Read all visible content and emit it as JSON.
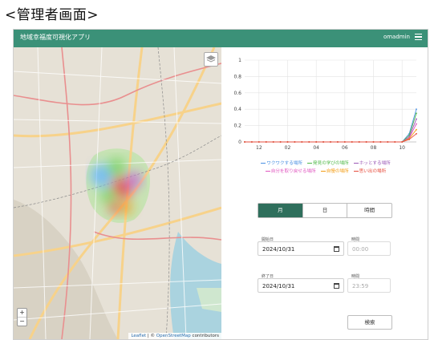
{
  "page": {
    "heading": "<管理者画面>"
  },
  "header": {
    "title": "地域幸福度可視化アプリ",
    "user": "omadmin"
  },
  "map": {
    "zoom_in": "+",
    "zoom_out": "−",
    "attribution": {
      "leaflet": "Leaflet",
      "sep": " | © ",
      "osm": "OpenStreetMap",
      "suffix": " contributors"
    }
  },
  "chart_data": {
    "type": "line",
    "x": [
      10,
      11,
      12,
      13,
      14,
      15,
      16,
      17,
      18,
      19,
      20,
      21,
      22,
      23,
      0,
      1,
      2,
      3,
      4,
      5,
      6,
      7,
      8,
      9,
      10
    ],
    "x_ticks": [
      "12",
      "02",
      "04",
      "06",
      "08",
      "10"
    ],
    "y_ticks": [
      "0",
      "0.2",
      "0.4",
      "0.6",
      "0.8",
      "1"
    ],
    "ylim": [
      0,
      1
    ],
    "grid": true,
    "legend_position": "bottom",
    "series": [
      {
        "name": "ワクワクする場所",
        "color": "#4a90e2",
        "values": [
          0,
          0,
          0,
          0,
          0,
          0,
          0,
          0,
          0,
          0,
          0,
          0,
          0,
          0,
          0,
          0,
          0,
          0,
          0,
          0,
          0,
          0,
          0,
          0.1,
          0.4
        ]
      },
      {
        "name": "発見の学びの場所",
        "color": "#50b848",
        "values": [
          0,
          0,
          0,
          0,
          0,
          0,
          0,
          0,
          0,
          0,
          0,
          0,
          0,
          0,
          0,
          0,
          0,
          0,
          0,
          0,
          0,
          0,
          0,
          0.08,
          0.35
        ]
      },
      {
        "name": "ホッとする場所",
        "color": "#9b59b6",
        "values": [
          0,
          0,
          0,
          0,
          0,
          0,
          0,
          0,
          0,
          0,
          0,
          0,
          0,
          0,
          0,
          0,
          0,
          0,
          0,
          0,
          0,
          0,
          0,
          0.06,
          0.28
        ]
      },
      {
        "name": "自分を取り戻せる場所",
        "color": "#e056c0",
        "values": [
          0,
          0,
          0,
          0,
          0,
          0,
          0,
          0,
          0,
          0,
          0,
          0,
          0,
          0,
          0,
          0,
          0,
          0,
          0,
          0,
          0,
          0,
          0,
          0.05,
          0.22
        ]
      },
      {
        "name": "自慢の場所",
        "color": "#f39c12",
        "values": [
          0,
          0,
          0,
          0,
          0,
          0,
          0,
          0,
          0,
          0,
          0,
          0,
          0,
          0,
          0,
          0,
          0,
          0,
          0,
          0,
          0,
          0,
          0,
          0.04,
          0.15
        ]
      },
      {
        "name": "思い出の場所",
        "color": "#e74c3c",
        "values": [
          0,
          0,
          0,
          0,
          0,
          0,
          0,
          0,
          0,
          0,
          0,
          0,
          0,
          0,
          0,
          0,
          0,
          0,
          0,
          0,
          0,
          0,
          0,
          0.03,
          0.1
        ]
      }
    ]
  },
  "tabs": [
    {
      "label": "月",
      "active": true
    },
    {
      "label": "日",
      "active": false
    },
    {
      "label": "時間",
      "active": false
    }
  ],
  "form": {
    "start_label": "開始日",
    "start_date": "2024/10/31",
    "start_time_label": "時間",
    "start_time": "00:00",
    "end_label": "終了日",
    "end_date": "2024/10/31",
    "end_time_label": "時間",
    "end_time": "23:59",
    "search_label": "検索"
  }
}
